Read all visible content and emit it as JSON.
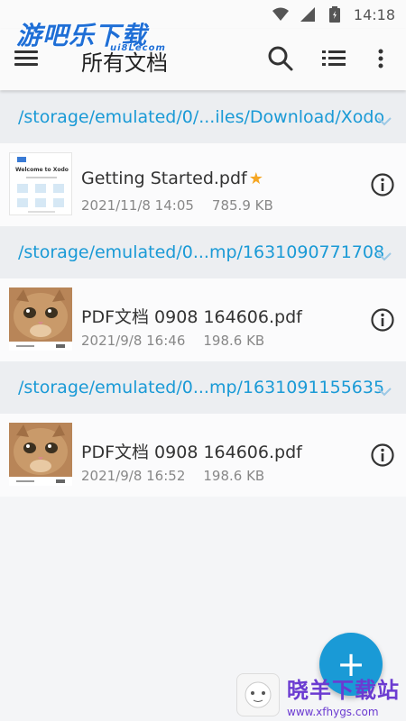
{
  "status_bar": {
    "time": "14:18"
  },
  "watermark_top": {
    "title": "游吧乐下载",
    "sub": "ui8Lecom"
  },
  "toolbar": {
    "title": "所有文档"
  },
  "groups": [
    {
      "path": "/storage/emulated/0/...iles/Download/Xodo",
      "file": {
        "name": "Getting Started.pdf",
        "date": "2021/11/8 14:05",
        "size": "785.9 KB",
        "starred": true,
        "thumb_title": "Welcome to Xodo"
      }
    },
    {
      "path": "/storage/emulated/0...mp/1631090771708",
      "file": {
        "name": "PDF文档 0908 164606.pdf",
        "date": "2021/9/8 16:46",
        "size": "198.6 KB",
        "starred": false
      }
    },
    {
      "path": "/storage/emulated/0...mp/1631091155635",
      "file": {
        "name": "PDF文档 0908 164606.pdf",
        "date": "2021/9/8 16:52",
        "size": "198.6 KB",
        "starred": false
      }
    }
  ],
  "fab": {
    "label": "+"
  },
  "watermark_bottom": {
    "title": "晓羊下载站",
    "url": "www.xfhygs.com"
  },
  "colors": {
    "accent": "#1a9ad6",
    "star": "#f5a623"
  }
}
